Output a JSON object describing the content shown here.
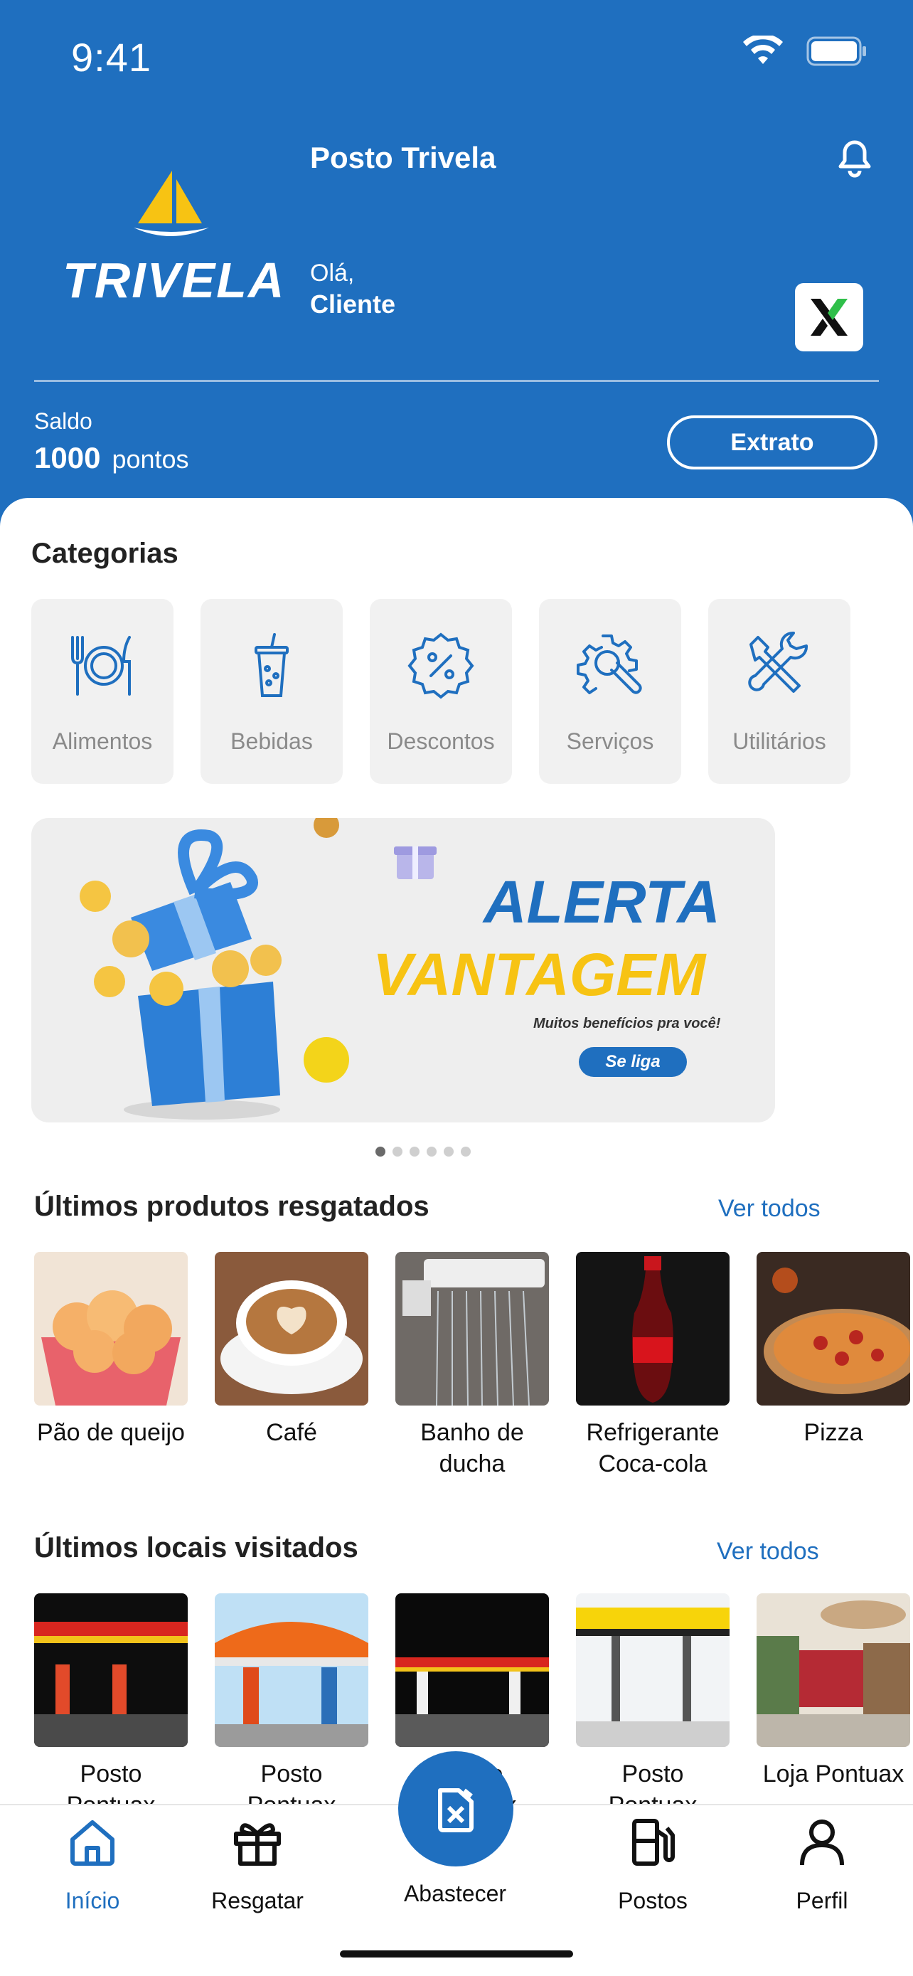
{
  "status_bar": {
    "time": "9:41"
  },
  "header": {
    "logo_text": "TRIVELA",
    "store_name": "Posto Trivela",
    "greeting": "Olá,",
    "user_name": "Cliente",
    "balance_label": "Saldo",
    "balance_value": "1000",
    "balance_unit": "pontos",
    "statement_button": "Extrato"
  },
  "categories": {
    "title": "Categorias",
    "items": [
      {
        "label": "Alimentos",
        "icon": "utensils-icon"
      },
      {
        "label": "Bebidas",
        "icon": "drink-cup-icon"
      },
      {
        "label": "Descontos",
        "icon": "percent-badge-icon"
      },
      {
        "label": "Serviços",
        "icon": "gear-wrench-icon"
      },
      {
        "label": "Utilitários",
        "icon": "tools-icon"
      }
    ]
  },
  "banner": {
    "line1": "ALERTA",
    "line2": "VANTAGEM",
    "subtitle": "Muitos benefícios pra você!",
    "button": "Se liga",
    "slide_count": 6,
    "active_slide": 1
  },
  "recent_products": {
    "title": "Últimos produtos resgatados",
    "see_all": "Ver todos",
    "items": [
      {
        "label": "Pão de queijo"
      },
      {
        "label": "Café"
      },
      {
        "label": "Banho de ducha"
      },
      {
        "label": "Refrigerante Coca-cola"
      },
      {
        "label": "Pizza"
      }
    ]
  },
  "recent_places": {
    "title": "Últimos locais visitados",
    "see_all": "Ver todos",
    "items": [
      {
        "label": "Posto Pontuax"
      },
      {
        "label": "Posto Pontuax"
      },
      {
        "label": "Posto Pontuax"
      },
      {
        "label": "Posto Pontuax"
      },
      {
        "label": "Loja Pontuax"
      }
    ]
  },
  "tab_bar": {
    "tabs": [
      {
        "label": "Início",
        "icon": "home-icon",
        "active": true
      },
      {
        "label": "Resgatar",
        "icon": "gift-icon",
        "active": false
      },
      {
        "label": "Abastecer",
        "icon": "fuel-can-icon",
        "active": false
      },
      {
        "label": "Postos",
        "icon": "gas-pump-icon",
        "active": false
      },
      {
        "label": "Perfil",
        "icon": "user-icon",
        "active": false
      }
    ]
  },
  "colors": {
    "primary": "#1f6fbf",
    "accent_yellow": "#f7c313"
  }
}
